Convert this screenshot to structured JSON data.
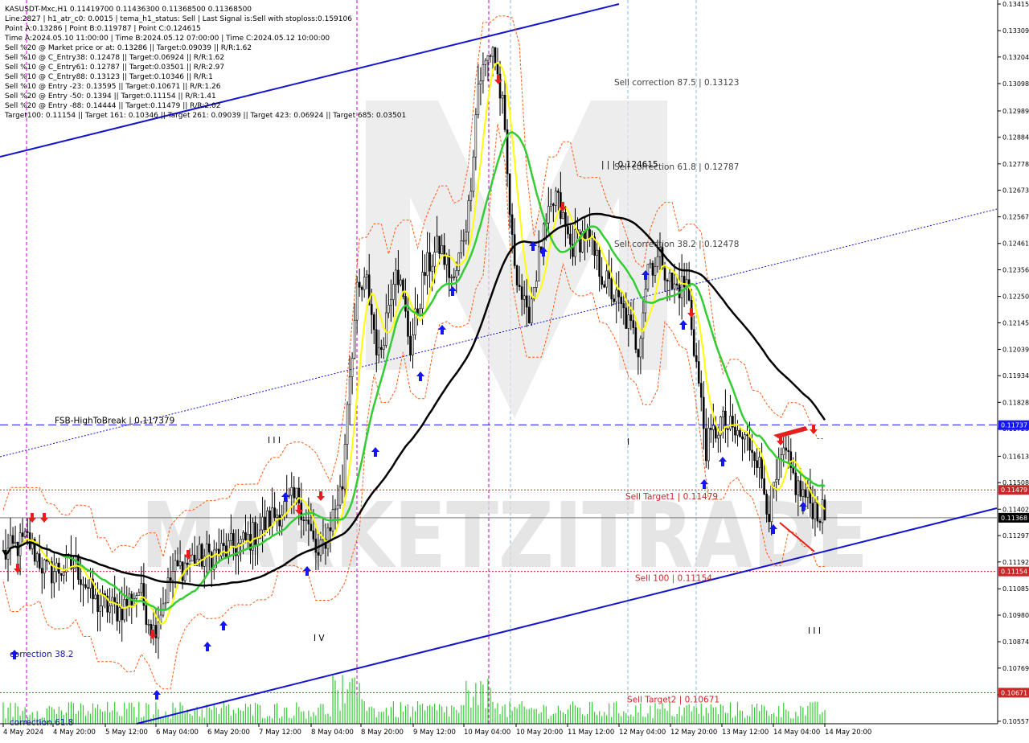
{
  "chart_data": {
    "type": "candlestick",
    "symbol_line": "KASUSDT-Mxc,H1  0.11419700 0.11436300 0.11368500 0.11368500",
    "info_lines": [
      "Line:2827  |  h1_atr_c0: 0.0015  |  tema_h1_status: Sell  |  Last Signal is:Sell with stoploss:0.159106",
      "Point A:0.13286  |  Point B:0.119787  |  Point C:0.124615",
      "Time A:2024.05.10 11:00:00  |  Time B:2024.05.12 07:00:00  |  Time C:2024.05.12 10:00:00",
      "Sell %20 @ Market price or at: 0.13286  ||  Target:0.09039  ||  R/R:1.62",
      "Sell %10 @ C_Entry38: 0.12478  ||  Target:0.06924  ||  R/R:1.62",
      "Sell %10 @ C_Entry61: 0.12787  ||  Target:0.03501  ||  R/R:2.97",
      "Sell %10 @ C_Entry88: 0.13123  ||  Target:0.10346  ||  R/R:1",
      "Sell %10 @ Entry -23: 0.13595  ||  Target:0.10671  ||  R/R:1.26",
      "Sell %20 @ Entry -50: 0.1394  ||  Target:0.11154  ||  R/R:1.41",
      "Sell %20 @ Entry -88: 0.14444  ||  Target:0.11479  ||  R/R:2.02",
      "Target100: 0.11154  ||  Target 161: 0.10346  ||  Target 261: 0.09039  ||  Target 423: 0.06924  ||  Target 685: 0.03501"
    ],
    "y_ticks": [
      "0.13415",
      "0.13309",
      "0.13204",
      "0.13098",
      "0.12989",
      "0.12884",
      "0.12778",
      "0.12673",
      "0.12567",
      "0.12461",
      "0.12356",
      "0.12250",
      "0.12145",
      "0.12039",
      "0.11934",
      "0.11828",
      "0.11723",
      "0.11613",
      "0.11508",
      "0.11402",
      "0.11297",
      "0.11192",
      "0.11085",
      "0.10980",
      "0.10874",
      "0.10769",
      "0.10663",
      "0.10557"
    ],
    "ylim": [
      0.10557,
      0.13415
    ],
    "x_ticks": [
      "4 May 2024",
      "4 May 20:00",
      "5 May 12:00",
      "6 May 04:00",
      "6 May 20:00",
      "7 May 12:00",
      "8 May 04:00",
      "8 May 20:00",
      "9 May 12:00",
      "10 May 04:00",
      "10 May 20:00",
      "11 May 12:00",
      "12 May 04:00",
      "12 May 20:00",
      "13 May 12:00",
      "14 May 04:00",
      "14 May 20:00"
    ],
    "price_boxes": [
      {
        "label": "0.11737",
        "value": 0.11737,
        "color": "#1414ff"
      },
      {
        "label": "0.11479",
        "value": 0.11479,
        "color": "#c82828"
      },
      {
        "label": "0.11368",
        "value": 0.11368,
        "color": "#000000"
      },
      {
        "label": "0.11154",
        "value": 0.11154,
        "color": "#c82828"
      },
      {
        "label": "0.10671",
        "value": 0.10671,
        "color": "#c82828"
      }
    ],
    "levels": [
      {
        "label": "FSB-HighToBreak  |  0.117379",
        "value": 0.117379,
        "color": "#1414ff",
        "style": "dashed"
      },
      {
        "label": "Sell Target1  |  0.11479",
        "value": 0.11479,
        "color": "#c82828",
        "style": "dotted"
      },
      {
        "label": "Sell 100  |  0.11154",
        "value": 0.11154,
        "color": "#c82828",
        "style": "dotted"
      },
      {
        "label": "Sell Target2  |  0.10671",
        "value": 0.10671,
        "color": "#c82828",
        "style": "dotted"
      },
      {
        "label": "",
        "value": 0.11368,
        "color": "#7a7a7a",
        "style": "solid"
      }
    ],
    "correction_labels": [
      {
        "label": "Sell correction 87.5  |  0.13123",
        "value": 0.13123
      },
      {
        "label": "Sell correction 61.8  |  0.12787",
        "value": 0.12787
      },
      {
        "label": "Sell correction 38.2  |  0.12478",
        "value": 0.12478
      },
      {
        "label": "correction 38.2",
        "value": 0.10842
      },
      {
        "label": "correction 61.8",
        "value": 0.10559
      }
    ],
    "point_c_label": "| | | 0.124615",
    "wave_labels": [
      "I I I",
      "I V",
      "I",
      "I I I"
    ],
    "watermark": "MARKETZITRADE",
    "colors": {
      "bull_candle": "#000000",
      "bear_candle": "#000000",
      "yellow_ma": "#ffff00",
      "green_ma": "#32cd32",
      "black_ma": "#000000",
      "channel": "#1414cc",
      "envelope": "#ff5a14",
      "volume": "#32cd32",
      "buy_arrow": "#1414ff",
      "sell_arrow": "#e61e1e",
      "time_marker": "#c800c8",
      "time_grid": "#8cb4dc"
    }
  }
}
